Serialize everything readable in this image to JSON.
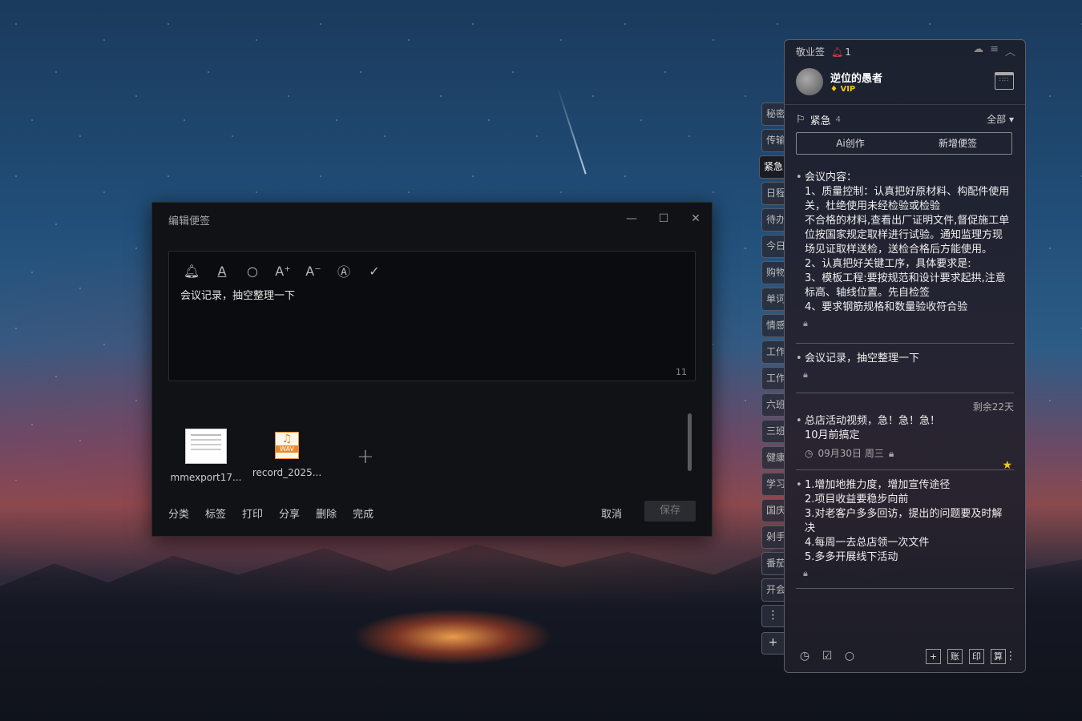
{
  "edit_dialog": {
    "title": "编辑便签",
    "content": "会议记录，抽空整理一下",
    "char_count": "11",
    "attachments": [
      {
        "name": "mmexport17...",
        "type": "image"
      },
      {
        "name": "record_2025...",
        "type": "wav",
        "badge": "WAV"
      }
    ],
    "actions": [
      "分类",
      "标签",
      "打印",
      "分享",
      "删除",
      "完成"
    ],
    "cancel": "取消",
    "save": "保存"
  },
  "side_tabs": [
    "秘密",
    "传输",
    "紧急",
    "日程",
    "待办",
    "今日",
    "购物",
    "单词",
    "情感",
    "工作",
    "工作",
    "六班",
    "三班",
    "健康",
    "学习",
    "国庆",
    "剁手",
    "番茄",
    "开会"
  ],
  "side_tab_active": "紧急",
  "panel": {
    "app_name": "敬业签",
    "notif_count": "1",
    "username": "逆位的愚者",
    "vip": "VIP",
    "category": "紧急",
    "category_count": "4",
    "filter": "全部",
    "btn_ai": "Ai创作",
    "btn_new": "新增便签",
    "notes": [
      {
        "text": "会议内容：\n1、质量控制：认真把好原材料、构配件使用关，杜绝使用未经检验或检验\n不合格的材料,查看出厂证明文件,督促施工单位按国家规定取样进行试验。通知监理方现场见证取样送检，送检合格后方能使用。\n2、认真把好关键工序，具体要求是:\n3、模板工程:要按规范和设计要求起拱,注意标高、轴线位置。先自检签\n4、要求钢筋规格和数量验收符合验"
      },
      {
        "text": "会议记录，抽空整理一下"
      },
      {
        "text": "总店活动视频，急！急！急！\n10月前搞定",
        "remain": "剩余22天",
        "date": "09月30日 周三"
      },
      {
        "text": "1.增加地推力度，增加宣传途径\n2.项目收益要稳步向前\n3.对老客户多多回访，提出的问题要及时解决\n4.每周一去总店领一次文件\n5.多多开展线下活动"
      }
    ],
    "bottom_boxes": [
      "+",
      "账",
      "印",
      "算"
    ]
  }
}
